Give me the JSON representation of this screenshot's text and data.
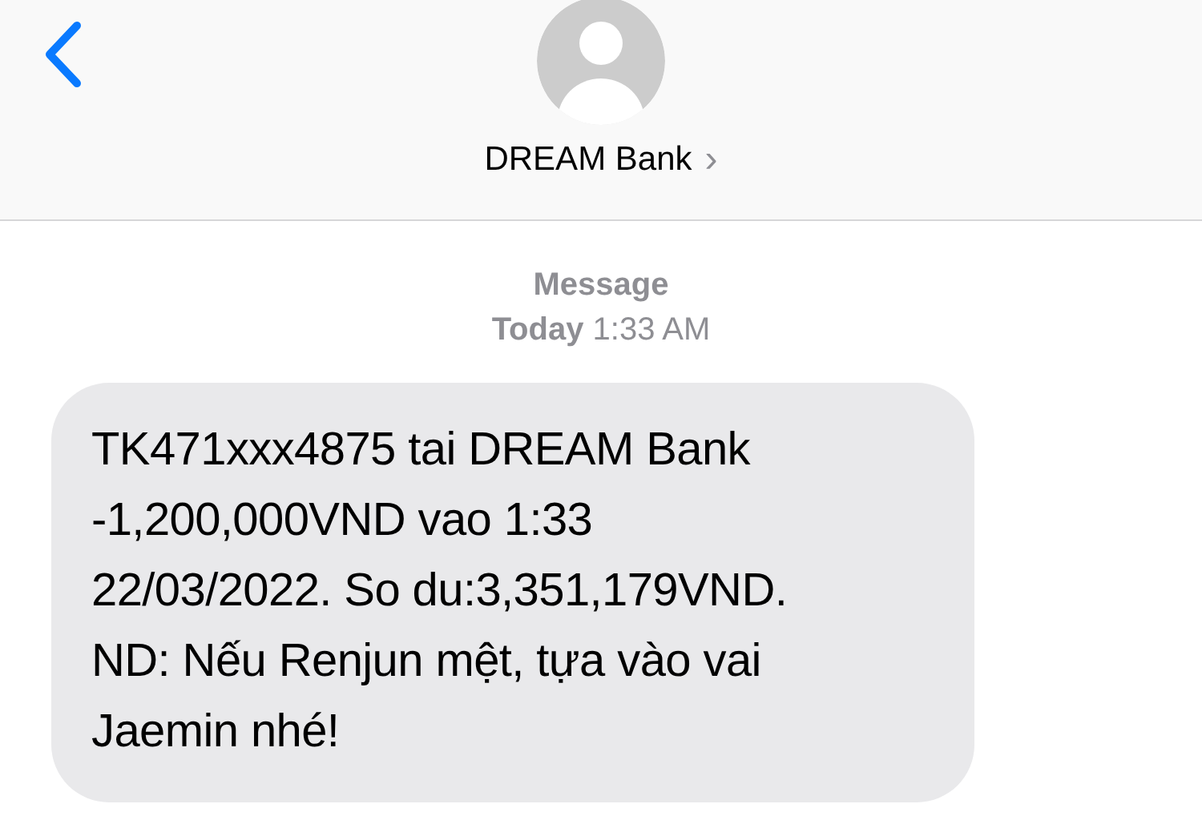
{
  "header": {
    "contact_name": "DREAM Bank",
    "chevron": "›"
  },
  "timestamp": {
    "service": "Message",
    "time": "**Today** 1:33 AM"
  },
  "messages": [
    {
      "kind": "received",
      "text": "TK471xxx4875 tai DREAM Bank\n-1,200,000VND vao 1:33\n22/03/2022. So du:3,351,179VND.\nND: Nếu Renjun mệt, tựa vào vai\nJaemin nhé!"
    }
  ]
}
